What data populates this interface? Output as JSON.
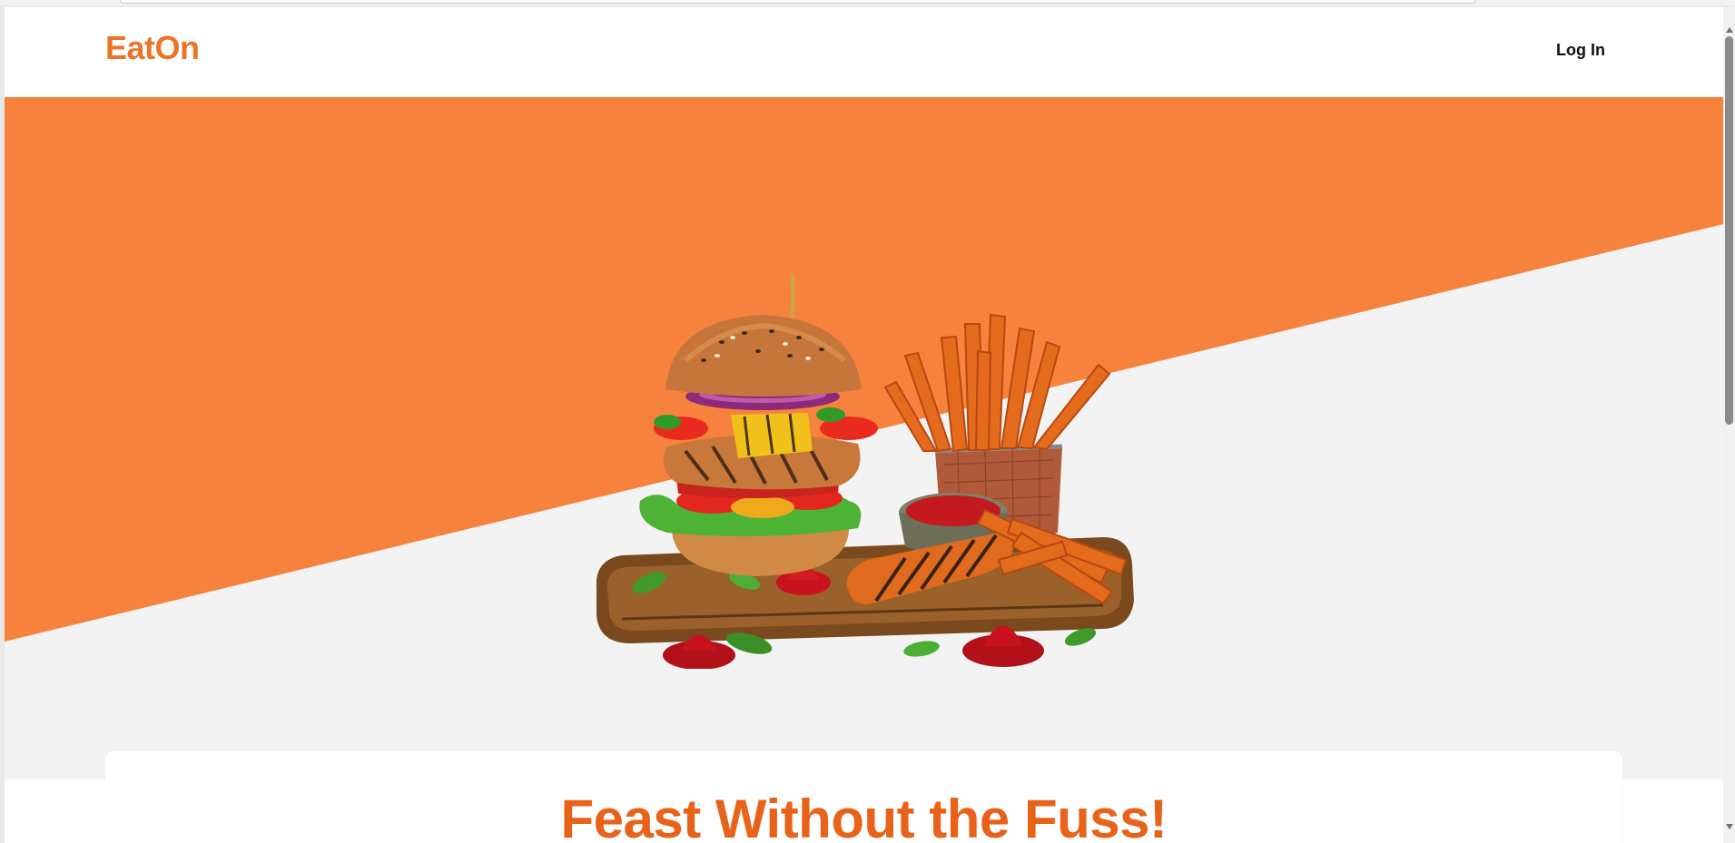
{
  "app": {
    "brand": "EatOn",
    "brand_color": "#ec7426",
    "accent_color": "#f6823d",
    "headline_color": "#e8621a"
  },
  "nav": {
    "login_label": "Log In"
  },
  "hero": {
    "illustration_icon": "burger-and-fries-illustration",
    "headline": "Feast Without the Fuss!"
  },
  "scrollbar": {
    "up_icon": "scroll-up-arrow-icon",
    "down_icon": "scroll-down-arrow-icon"
  }
}
